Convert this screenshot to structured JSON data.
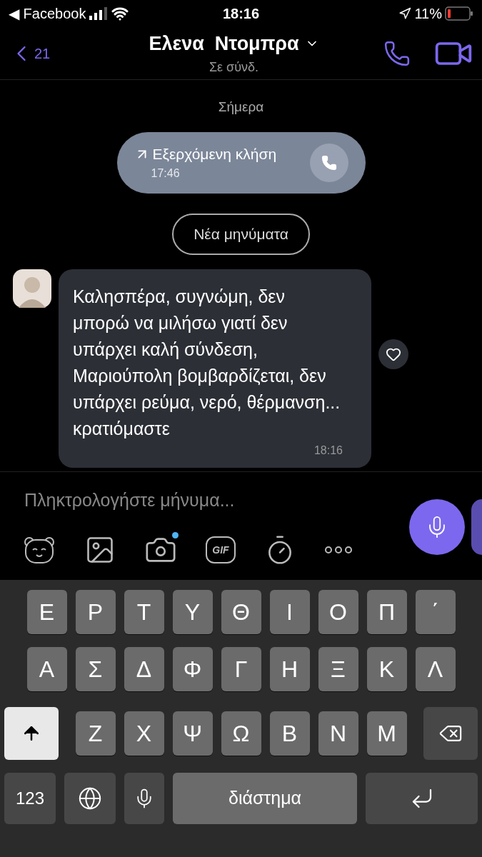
{
  "status_bar": {
    "back_glyph": "◀",
    "back_app": "Facebook",
    "time": "18:16",
    "battery": "11%"
  },
  "header": {
    "back_count": "21",
    "title": "Ελενα  Ντομπρα",
    "subtitle": "Σε σύνδ."
  },
  "date_divider": "Σήμερα",
  "call_bubble": {
    "label": "Εξερχόμενη κλήση",
    "time": "17:46"
  },
  "new_messages": "Νέα μηνύματα",
  "message": {
    "text": "Καλησπέρα, συγνώμη, δεν μπορώ να μιλήσω γιατί δεν υπάρχει καλή σύνδεση, Μαριούπολη βομβαρδίζεται, δεν υπάρχει ρεύμα, νερό, θέρμανση... κρατιόμαστε",
    "time": "18:16",
    "liked": false
  },
  "composer": {
    "placeholder": "Πληκτρολογήστε μήνυμα...",
    "gif_label": "GIF",
    "camera_badge": true
  },
  "keyboard": {
    "top_row": [
      "Ε",
      "Ρ",
      "Τ",
      "Υ",
      "Θ",
      "Ι",
      "Ο",
      "Π",
      "΄"
    ],
    "middle_row": [
      "Α",
      "Σ",
      "Δ",
      "Φ",
      "Γ",
      "Η",
      "Ξ",
      "Κ",
      "Λ"
    ],
    "bottom_row": [
      "Ζ",
      "Χ",
      "Ψ",
      "Ω",
      "Β",
      "Ν",
      "Μ"
    ],
    "numbers_key": "123",
    "space_key": "διάστημα",
    "shift_on": true
  }
}
